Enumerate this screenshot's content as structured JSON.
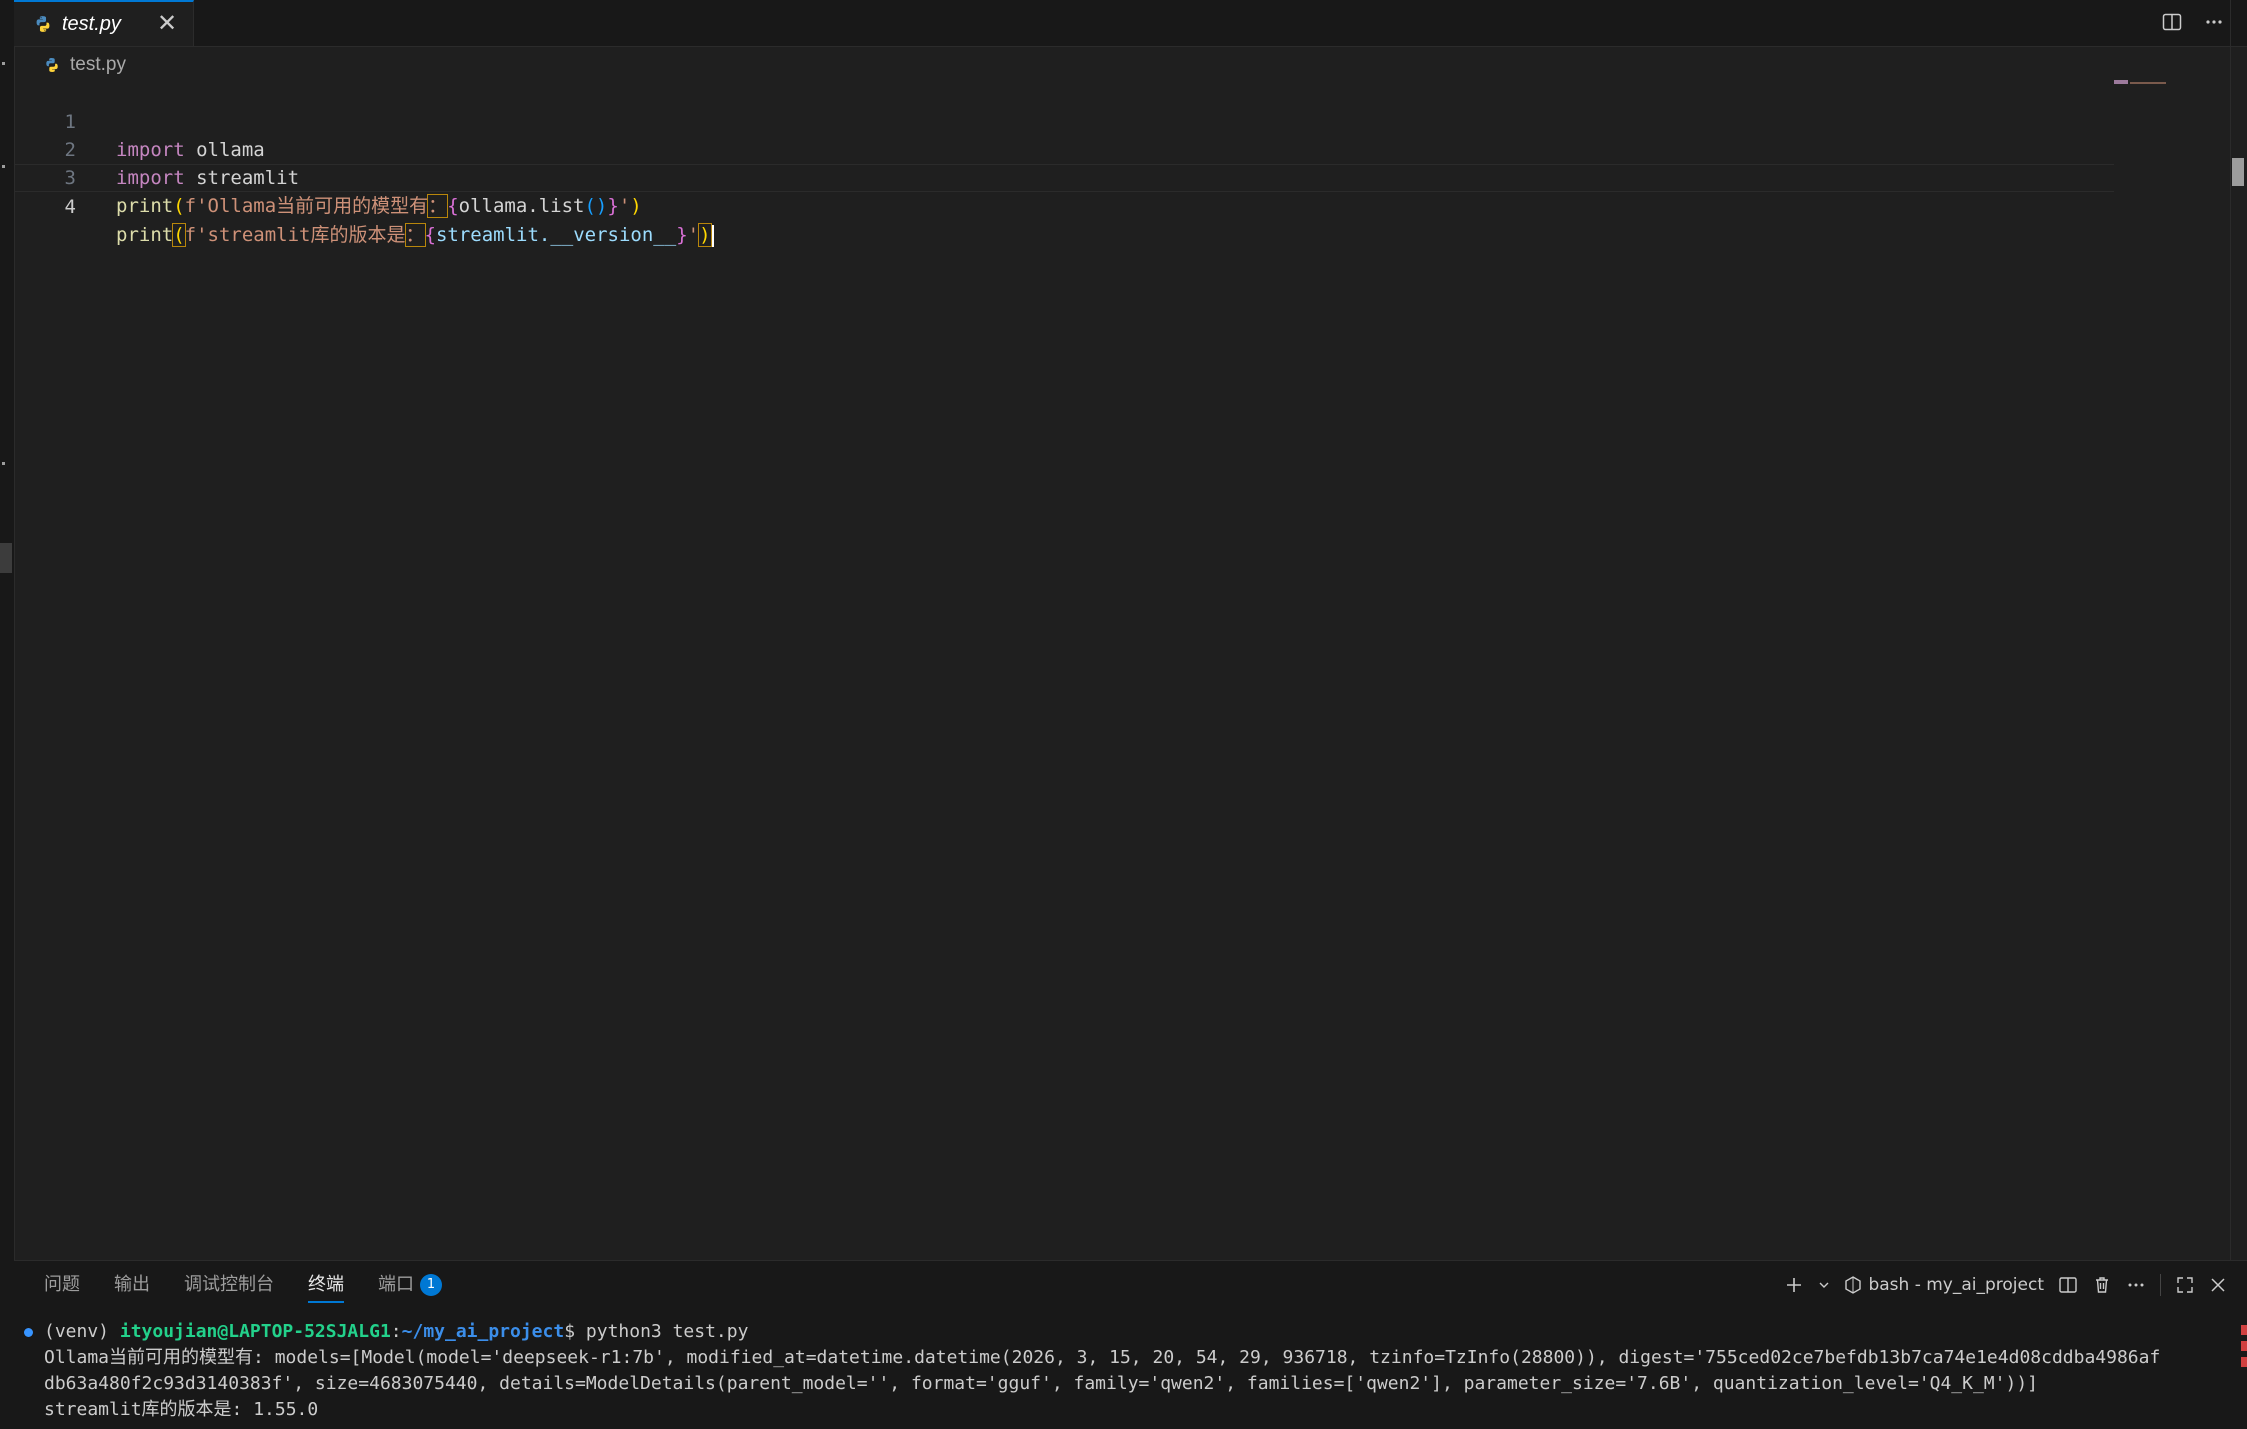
{
  "tab": {
    "label": "test.py",
    "close": "✕"
  },
  "breadcrumb": {
    "file": "test.py"
  },
  "editor": {
    "lines": [
      {
        "n": "1",
        "kw": "import",
        "rest": " ollama"
      },
      {
        "n": "2",
        "kw": "import",
        "rest": " streamlit"
      },
      {
        "n": "3",
        "fn": "print",
        "open": "(",
        "pre": "f'Ollama当前可用的模型有",
        "colon": "：",
        "lb": "{",
        "expr1": "ollama.list",
        "call": "()",
        "rb": "}",
        "q": "'",
        "close": ")"
      },
      {
        "n": "4",
        "fn": "print",
        "open": "(",
        "pre": "f'streamlit库的版本是",
        "colon": "：",
        "lb": "{",
        "expr1": "streamlit.__version__",
        "rb": "}",
        "q": "'",
        "close": ")"
      }
    ]
  },
  "panel": {
    "tabs": [
      "问题",
      "输出",
      "调试控制台",
      "终端",
      "端口"
    ],
    "active_tab": "终端",
    "ports_badge": "1",
    "terminal_name": "bash - my_ai_project"
  },
  "terminal": {
    "prompt_venv": "(venv) ",
    "prompt_user": "ityoujian@LAPTOP-52SJALG1",
    "prompt_sep": ":",
    "prompt_path": "~/my_ai_project",
    "prompt_end": "$ ",
    "command": "python3 test.py",
    "out1": "Ollama当前可用的模型有: models=[Model(model='deepseek-r1:7b', modified_at=datetime.datetime(2026, 3, 15, 20, 54, 29, 936718, tzinfo=TzInfo(28800)), digest='755ced02ce7befdb13b7ca74e1e4d08cddba4986af",
    "out2": "db63a480f2c93d3140383f', size=4683075440, details=ModelDetails(parent_model='', format='gguf', family='qwen2', families=['qwen2'], parameter_size='7.6B', quantization_level='Q4_K_M'))]",
    "out3": "streamlit库的版本是: 1.55.0"
  },
  "colors": {
    "accent": "#0078d4",
    "keyword": "#c586c0",
    "string": "#ce9178",
    "function": "#dcdcaa",
    "variable": "#9cdcfe"
  }
}
